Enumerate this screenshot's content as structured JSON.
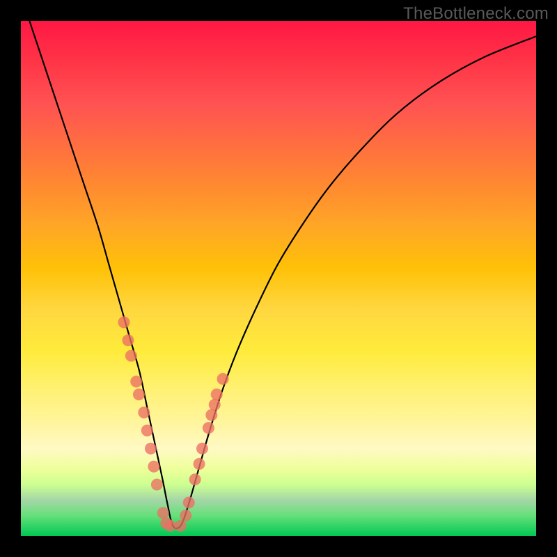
{
  "watermark": "TheBottleneck.com",
  "chart_data": {
    "type": "line",
    "title": "",
    "xlabel": "",
    "ylabel": "",
    "xlim": [
      0,
      100
    ],
    "ylim": [
      0,
      100
    ],
    "curve": {
      "name": "bottleneck-curve",
      "x": [
        0,
        3,
        6,
        9,
        12,
        15,
        17,
        19,
        21,
        23,
        24.5,
        26,
        27.5,
        28.5,
        29.5,
        31,
        32.5,
        34.5,
        36.5,
        39,
        42,
        46,
        50,
        55,
        60,
        66,
        73,
        81,
        90,
        100
      ],
      "y": [
        105,
        96,
        87,
        78,
        69,
        60,
        53,
        46,
        39,
        32,
        25,
        18,
        11,
        6,
        2,
        2,
        6,
        13,
        20,
        28,
        36,
        45,
        53,
        61,
        68,
        75,
        82,
        88,
        93,
        97
      ]
    },
    "markers": {
      "name": "sample-points",
      "x": [
        20.0,
        20.8,
        21.4,
        22.4,
        22.9,
        23.9,
        24.5,
        25.2,
        25.8,
        26.4,
        27.6,
        28.2,
        29.0,
        31.0,
        32.0,
        32.6,
        33.8,
        34.6,
        35.2,
        36.4,
        37.0,
        37.6,
        38.0,
        39.2
      ],
      "y": [
        41.5,
        38.0,
        35.0,
        30.0,
        27.5,
        24.0,
        20.5,
        17.0,
        13.5,
        10.0,
        4.5,
        2.5,
        2.0,
        2.0,
        4.0,
        6.5,
        11.0,
        14.0,
        17.0,
        21.0,
        23.5,
        25.5,
        27.5,
        30.5
      ]
    },
    "gradient_stops": [
      {
        "pos": 0,
        "color": "#ff1744"
      },
      {
        "pos": 50,
        "color": "#ffd740"
      },
      {
        "pos": 85,
        "color": "#fff9c4"
      },
      {
        "pos": 100,
        "color": "#00c853"
      }
    ]
  }
}
